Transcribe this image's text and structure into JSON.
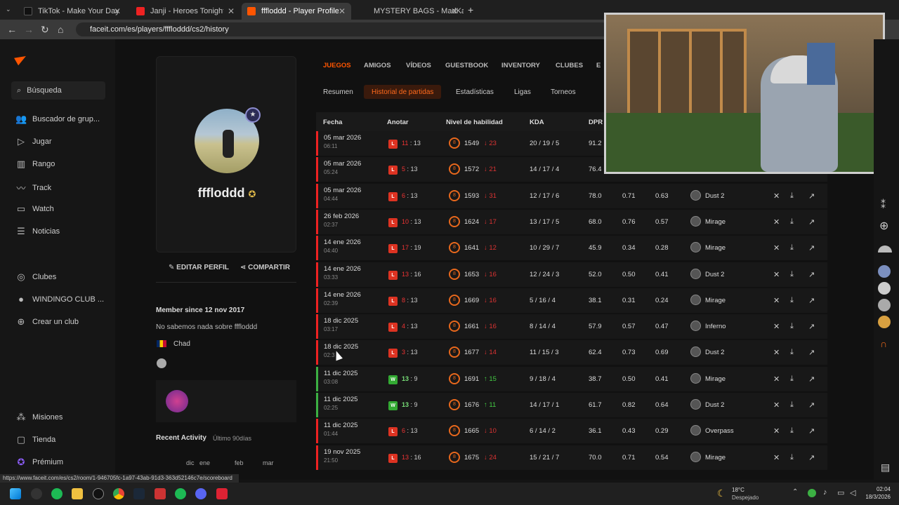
{
  "browser": {
    "tabs": [
      {
        "label": "TikTok - Make Your Day",
        "color": "#111"
      },
      {
        "label": "Janji - Heroes Tonight (feat. Joh",
        "color": "#e22"
      },
      {
        "label": "fffloddd - Player Profile - FACEI",
        "color": "#ff5500"
      },
      {
        "label": "MYSTERY BAGS - MadKat",
        "color": "#444"
      }
    ],
    "url": "faceit.com/es/players/fffloddd/cs2/history"
  },
  "sidebar": {
    "search_placeholder": "Búsqueda",
    "items": [
      {
        "label": "Buscador de grup...",
        "icon": "users-icon"
      },
      {
        "label": "Jugar",
        "icon": "play-icon"
      },
      {
        "label": "Rango",
        "icon": "chart-icon"
      },
      {
        "label": "Track",
        "icon": "track-icon"
      },
      {
        "label": "Watch",
        "icon": "tv-icon"
      },
      {
        "label": "Noticias",
        "icon": "news-icon"
      }
    ],
    "clubs": [
      {
        "label": "Clubes"
      },
      {
        "label": "WINDINGO CLUB ..."
      },
      {
        "label": "Crear un club"
      }
    ],
    "bottom": [
      {
        "label": "Misiones"
      },
      {
        "label": "Tienda"
      },
      {
        "label": "Prémium"
      }
    ]
  },
  "profile": {
    "name": "fffloddd",
    "edit_label": "EDITAR PERFIL",
    "share_label": "COMPARTIR",
    "member_since": "Member since 12 nov 2017",
    "bio": "No sabemos nada sobre fffloddd",
    "country": "Chad",
    "recent_activity": "Recent Activity",
    "recent_range": "Último 90días",
    "months": [
      "dic",
      "ene",
      "feb",
      "mar"
    ]
  },
  "nav_tabs": [
    "JUEGOS",
    "AMIGOS",
    "VÍDEOS",
    "GUESTBOOK",
    "INVENTORY",
    "CLUBES",
    "E"
  ],
  "sub_tabs": [
    "Resumen",
    "Historial de partidas",
    "Estadísticas",
    "Ligas",
    "Torneos"
  ],
  "table": {
    "headers": [
      "Fecha",
      "Anotar",
      "Nivel de habilidad",
      "KDA",
      "DPR"
    ],
    "rows": [
      {
        "date": "05 mar 2026",
        "time": "06:11",
        "result": "L",
        "s1": "11",
        "s2": "13",
        "lvl": "8",
        "elo": "1549",
        "delta": "23",
        "kda": "20 / 19 / 5",
        "dpr": "91.2",
        "kr": "",
        "hs": "",
        "map": "",
        "win": false
      },
      {
        "date": "05 mar 2026",
        "time": "05:24",
        "result": "L",
        "s1": "5",
        "s2": "13",
        "lvl": "8",
        "elo": "1572",
        "delta": "21",
        "kda": "14 / 17 / 4",
        "dpr": "76.4",
        "kr": "",
        "hs": "",
        "map": "",
        "win": false
      },
      {
        "date": "05 mar 2026",
        "time": "04:44",
        "result": "L",
        "s1": "6",
        "s2": "13",
        "lvl": "8",
        "elo": "1593",
        "delta": "31",
        "kda": "12 / 17 / 6",
        "dpr": "78.0",
        "kr": "0.71",
        "hs": "0.63",
        "map": "Dust 2",
        "win": false
      },
      {
        "date": "26 feb 2026",
        "time": "02:37",
        "result": "L",
        "s1": "10",
        "s2": "13",
        "lvl": "8",
        "elo": "1624",
        "delta": "17",
        "kda": "13 / 17 / 5",
        "dpr": "68.0",
        "kr": "0.76",
        "hs": "0.57",
        "map": "Mirage",
        "win": false
      },
      {
        "date": "14 ene 2026",
        "time": "04:40",
        "result": "L",
        "s1": "17",
        "s2": "19",
        "lvl": "8",
        "elo": "1641",
        "delta": "12",
        "kda": "10 / 29 / 7",
        "dpr": "45.9",
        "kr": "0.34",
        "hs": "0.28",
        "map": "Mirage",
        "win": false
      },
      {
        "date": "14 ene 2026",
        "time": "03:33",
        "result": "L",
        "s1": "13",
        "s2": "16",
        "lvl": "8",
        "elo": "1653",
        "delta": "16",
        "kda": "12 / 24 / 3",
        "dpr": "52.0",
        "kr": "0.50",
        "hs": "0.41",
        "map": "Dust 2",
        "win": false
      },
      {
        "date": "14 ene 2026",
        "time": "02:39",
        "result": "L",
        "s1": "8",
        "s2": "13",
        "lvl": "8",
        "elo": "1669",
        "delta": "16",
        "kda": "5 / 16 / 4",
        "dpr": "38.1",
        "kr": "0.31",
        "hs": "0.24",
        "map": "Mirage",
        "win": false
      },
      {
        "date": "18 dic 2025",
        "time": "03:17",
        "result": "L",
        "s1": "4",
        "s2": "13",
        "lvl": "8",
        "elo": "1661",
        "delta": "16",
        "kda": "8 / 14 / 4",
        "dpr": "57.9",
        "kr": "0.57",
        "hs": "0.47",
        "map": "Inferno",
        "win": false
      },
      {
        "date": "18 dic 2025",
        "time": "02:3",
        "result": "L",
        "s1": "3",
        "s2": "13",
        "lvl": "8",
        "elo": "1677",
        "delta": "14",
        "kda": "11 / 15 / 3",
        "dpr": "62.4",
        "kr": "0.73",
        "hs": "0.69",
        "map": "Dust 2",
        "win": false
      },
      {
        "date": "11 dic 2025",
        "time": "03:08",
        "result": "W",
        "s1": "13",
        "s2": "9",
        "lvl": "8",
        "elo": "1691",
        "delta": "15",
        "kda": "9 / 18 / 4",
        "dpr": "38.7",
        "kr": "0.50",
        "hs": "0.41",
        "map": "Mirage",
        "win": true
      },
      {
        "date": "11 dic 2025",
        "time": "02:25",
        "result": "W",
        "s1": "13",
        "s2": "9",
        "lvl": "8",
        "elo": "1676",
        "delta": "11",
        "kda": "14 / 17 / 1",
        "dpr": "61.7",
        "kr": "0.82",
        "hs": "0.64",
        "map": "Dust 2",
        "win": true
      },
      {
        "date": "11 dic 2025",
        "time": "01:44",
        "result": "L",
        "s1": "6",
        "s2": "13",
        "lvl": "8",
        "elo": "1665",
        "delta": "10",
        "kda": "6 / 14 / 2",
        "dpr": "36.1",
        "kr": "0.43",
        "hs": "0.29",
        "map": "Overpass",
        "win": false
      },
      {
        "date": "19 nov 2025",
        "time": "21:50",
        "result": "L",
        "s1": "13",
        "s2": "16",
        "lvl": "8",
        "elo": "1675",
        "delta": "24",
        "kda": "15 / 21 / 7",
        "dpr": "70.0",
        "kr": "0.71",
        "hs": "0.54",
        "map": "Mirage",
        "win": false
      }
    ]
  },
  "status_url": "https://www.faceit.com/es/cs2/room/1-946705fc-1a97-43ab-91d3-363d52146c7e/scoreboard",
  "taskbar": {
    "temp": "18°C",
    "weather": "Despejado",
    "time": "02:04",
    "date": "18/3/2026"
  },
  "colors": {
    "accent": "#ff5500",
    "loss": "#e22222",
    "win": "#3cb043"
  }
}
